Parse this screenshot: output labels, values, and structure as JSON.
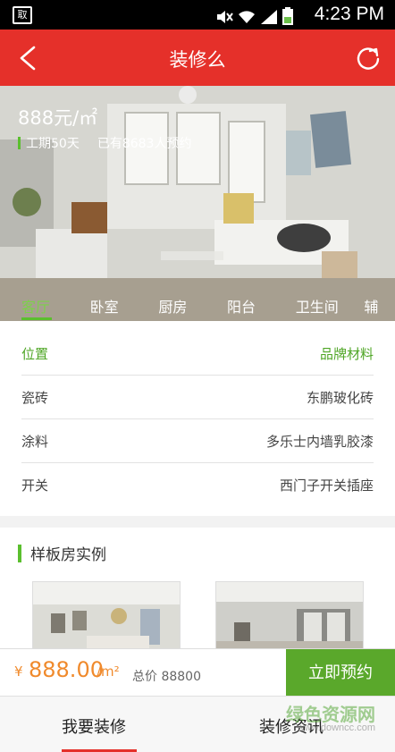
{
  "status_bar": {
    "time": "4:23 PM",
    "app_icon_text": "取"
  },
  "header": {
    "title": "装修么"
  },
  "hero": {
    "price": "888元/㎡",
    "duration": "工期50天",
    "reservations": "已有8683人预约"
  },
  "room_tabs": [
    "客厅",
    "卧室",
    "厨房",
    "阳台",
    "卫生间",
    "辅"
  ],
  "specs": {
    "head": {
      "left": "位置",
      "right": "品牌材料"
    },
    "rows": [
      {
        "left": "瓷砖",
        "right": "东鹏玻化砖"
      },
      {
        "left": "涂料",
        "right": "多乐士内墙乳胶漆"
      },
      {
        "left": "开关",
        "right": "西门子开关插座"
      }
    ]
  },
  "samples": {
    "title": "样板房实例"
  },
  "order": {
    "currency": "¥",
    "amount": "888.00",
    "unit": "/m²",
    "total": "总价 88800",
    "book_label": "立即预约"
  },
  "bottom_nav": {
    "tab1": "我要装修",
    "tab2": "装修资讯"
  },
  "watermark": {
    "line1": "绿色资源网",
    "line2": "www.downcc.com"
  },
  "colors": {
    "brand_red": "#e5302a",
    "accent_green": "#5bbf2e",
    "price_orange": "#f08a2c"
  }
}
